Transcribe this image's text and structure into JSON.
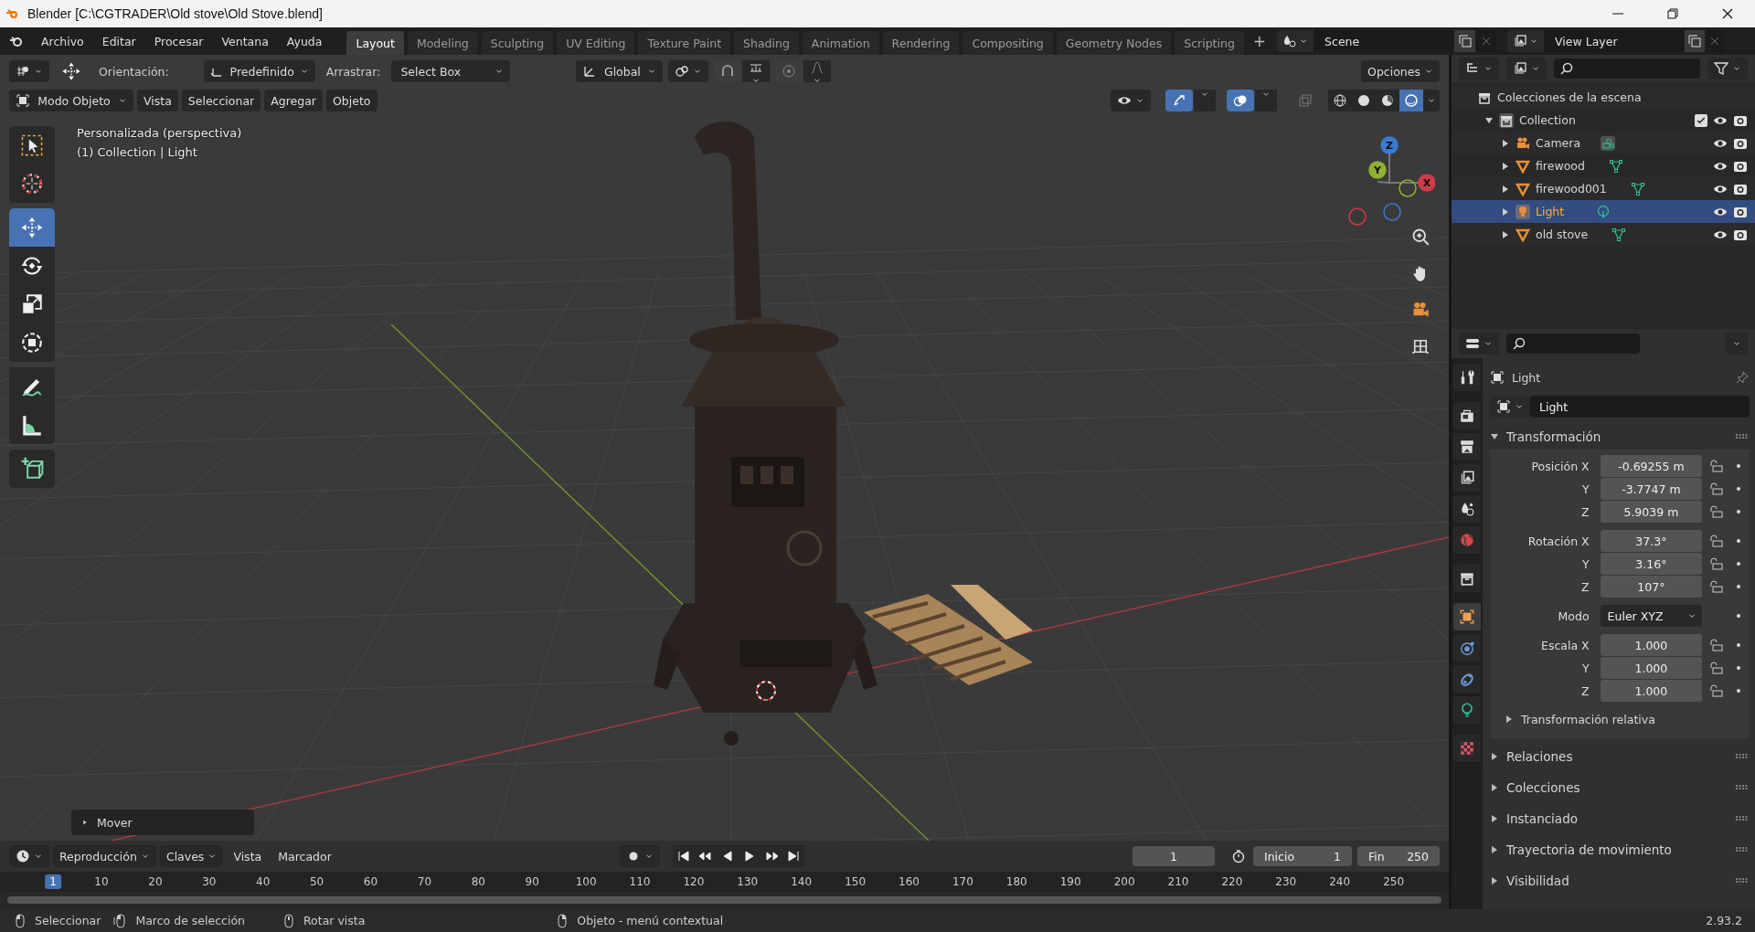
{
  "window": {
    "title": "Blender [C:\\CGTRADER\\Old stove\\Old Stove.blend]"
  },
  "menu": [
    "Archivo",
    "Editar",
    "Procesar",
    "Ventana",
    "Ayuda"
  ],
  "workspace_tabs": [
    {
      "label": "Layout",
      "selected": true
    },
    {
      "label": "Modeling",
      "selected": false
    },
    {
      "label": "Sculpting",
      "selected": false
    },
    {
      "label": "UV Editing",
      "selected": false
    },
    {
      "label": "Texture Paint",
      "selected": false
    },
    {
      "label": "Shading",
      "selected": false
    },
    {
      "label": "Animation",
      "selected": false
    },
    {
      "label": "Rendering",
      "selected": false
    },
    {
      "label": "Compositing",
      "selected": false
    },
    {
      "label": "Geometry Nodes",
      "selected": false
    },
    {
      "label": "Scripting",
      "selected": false
    }
  ],
  "add_workspace": "+",
  "scene": "Scene",
  "view_layer": "View Layer",
  "viewport": {
    "orientation_label": "Orientación:",
    "orientation": "Predefinido",
    "drag_label": "Arrastrar:",
    "drag": "Select Box",
    "transform_orientation": "Global",
    "options": "Opciones",
    "mode": "Modo Objeto",
    "menus": [
      "Vista",
      "Seleccionar",
      "Agregar",
      "Objeto"
    ],
    "gizmos_on": true,
    "overlays_on": true,
    "xray_on": false,
    "shading_modes": [
      {
        "kind": "wireframe",
        "selected": false
      },
      {
        "kind": "solid",
        "selected": false
      },
      {
        "kind": "material",
        "selected": false
      },
      {
        "kind": "rendered",
        "selected": true
      }
    ],
    "view_name": "Personalizada (perspectiva)",
    "view_info": "(1) Collection | Light",
    "toolbar": [
      {
        "tools": [
          {
            "kind": "select",
            "selected": false
          },
          {
            "kind": "cursor",
            "selected": false
          }
        ]
      },
      {
        "tools": [
          {
            "kind": "move",
            "selected": true
          },
          {
            "kind": "rotate",
            "selected": false
          },
          {
            "kind": "scale",
            "selected": false
          },
          {
            "kind": "transform",
            "selected": false
          }
        ]
      },
      {
        "tools": [
          {
            "kind": "annotate",
            "selected": false
          },
          {
            "kind": "measure",
            "selected": false
          }
        ]
      },
      {
        "tools": [
          {
            "kind": "add_cube",
            "selected": false
          }
        ]
      }
    ],
    "axes": {
      "x": "X",
      "y": "Y",
      "z": "Z"
    },
    "operator_panel": "Mover"
  },
  "outliner": {
    "title": "Colecciones de la escena",
    "collection": {
      "name": "Collection",
      "checked": true,
      "expanded": true,
      "children": [
        {
          "name": "Camera",
          "kind": "camera",
          "selected": false
        },
        {
          "name": "firewood",
          "kind": "mesh",
          "selected": false
        },
        {
          "name": "firewood001",
          "kind": "mesh",
          "selected": false
        },
        {
          "name": "Light",
          "kind": "light",
          "selected": true
        },
        {
          "name": "old stove",
          "kind": "mesh",
          "selected": false
        }
      ]
    }
  },
  "properties": {
    "tabs": [
      {
        "kind": "tool",
        "selected": false
      },
      {
        "kind": "render",
        "selected": false
      },
      {
        "kind": "output",
        "selected": false
      },
      {
        "kind": "view_layer",
        "selected": false
      },
      {
        "kind": "scene",
        "selected": false
      },
      {
        "kind": "world",
        "selected": false
      },
      {
        "kind": "collection",
        "selected": false
      },
      {
        "kind": "object",
        "selected": true
      },
      {
        "kind": "physics",
        "selected": false
      },
      {
        "kind": "constraints",
        "selected": false
      },
      {
        "kind": "light",
        "selected": false
      },
      {
        "kind": "texture",
        "selected": false
      }
    ],
    "object_name": "Light",
    "name_field": "Light",
    "panel": {
      "title": "Transformación",
      "expanded": true,
      "groups": [
        {
          "rows": [
            {
              "label": "Posición X",
              "value": "-0.69255 m",
              "kind": "number"
            },
            {
              "label": "Y",
              "value": "-3.7747 m",
              "kind": "number"
            },
            {
              "label": "Z",
              "value": "5.9039 m",
              "kind": "number"
            }
          ]
        },
        {
          "rows": [
            {
              "label": "Rotación X",
              "value": "37.3°",
              "kind": "number"
            },
            {
              "label": "Y",
              "value": "3.16°",
              "kind": "number"
            },
            {
              "label": "Z",
              "value": "107°",
              "kind": "number"
            }
          ]
        },
        {
          "rows": [
            {
              "label": "Modo",
              "value": "Euler XYZ",
              "kind": "dropdown"
            }
          ]
        },
        {
          "rows": [
            {
              "label": "Escala X",
              "value": "1.000",
              "kind": "number"
            },
            {
              "label": "Y",
              "value": "1.000",
              "kind": "number"
            },
            {
              "label": "Z",
              "value": "1.000",
              "kind": "number"
            }
          ]
        }
      ],
      "subpanel": "Transformación relativa"
    },
    "collapsed": [
      "Relaciones",
      "Colecciones",
      "Instanciado",
      "Trayectoria de movimiento",
      "Visibilidad"
    ]
  },
  "timeline": {
    "menus": [
      "Reproducción",
      "Claves",
      "Vista",
      "Marcador"
    ],
    "current_frame": "1",
    "start_label": "Inicio",
    "start": "1",
    "end_label": "Fin",
    "end": "250",
    "ruler": [
      {
        "label": "1",
        "selected": true
      },
      {
        "label": "10",
        "selected": false
      },
      {
        "label": "20",
        "selected": false
      },
      {
        "label": "30",
        "selected": false
      },
      {
        "label": "40",
        "selected": false
      },
      {
        "label": "50",
        "selected": false
      },
      {
        "label": "60",
        "selected": false
      },
      {
        "label": "70",
        "selected": false
      },
      {
        "label": "80",
        "selected": false
      },
      {
        "label": "90",
        "selected": false
      },
      {
        "label": "100",
        "selected": false
      },
      {
        "label": "110",
        "selected": false
      },
      {
        "label": "120",
        "selected": false
      },
      {
        "label": "130",
        "selected": false
      },
      {
        "label": "140",
        "selected": false
      },
      {
        "label": "150",
        "selected": false
      },
      {
        "label": "160",
        "selected": false
      },
      {
        "label": "170",
        "selected": false
      },
      {
        "label": "180",
        "selected": false
      },
      {
        "label": "190",
        "selected": false
      },
      {
        "label": "200",
        "selected": false
      },
      {
        "label": "210",
        "selected": false
      },
      {
        "label": "220",
        "selected": false
      },
      {
        "label": "230",
        "selected": false
      },
      {
        "label": "240",
        "selected": false
      },
      {
        "label": "250",
        "selected": false
      }
    ]
  },
  "status_bar": {
    "items": [
      {
        "kind": "left",
        "label": "Seleccionar"
      },
      {
        "kind": "drag",
        "label": "Marco de selección"
      },
      {
        "kind": "middle",
        "label": "Rotar vista"
      },
      {
        "kind": "right",
        "label": "Objeto - menú contextual"
      }
    ],
    "version": "2.93.2"
  }
}
